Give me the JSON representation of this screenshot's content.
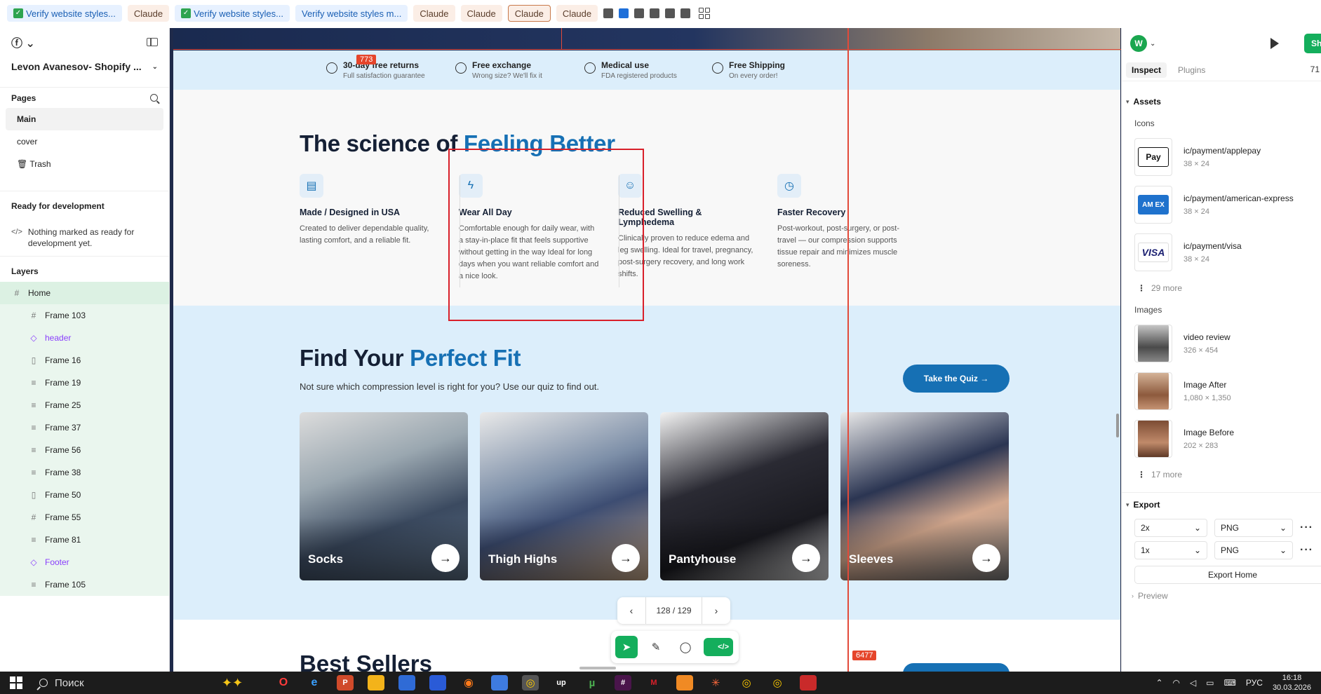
{
  "tabs": [
    {
      "label": "Verify website styles...",
      "style": "verify-g"
    },
    {
      "label": "Claude",
      "style": "claude"
    },
    {
      "label": "Verify website styles...",
      "style": "verify-g"
    },
    {
      "label": "Verify website styles m...",
      "style": "verify-b"
    },
    {
      "label": "Claude",
      "style": "claude"
    },
    {
      "label": "Claude",
      "style": "claude"
    },
    {
      "label": "Claude",
      "style": "claude active"
    },
    {
      "label": "Claude",
      "style": "claude"
    }
  ],
  "left_panel": {
    "project_name": "Levon Avanesov- Shopify ...",
    "pages_label": "Pages",
    "pages": [
      "Main",
      "cover",
      "🗑 Trash"
    ],
    "ready_label": "Ready for development",
    "ready_note": "Nothing marked as ready for development yet.",
    "layers_label": "Layers",
    "root_layer": "Home",
    "layers": [
      {
        "name": "Frame 103",
        "icon": "#",
        "kind": "frame"
      },
      {
        "name": "header",
        "icon": "◇",
        "kind": "comp"
      },
      {
        "name": "Frame 16",
        "icon": "▯",
        "kind": "frame"
      },
      {
        "name": "Frame 19",
        "icon": "≡",
        "kind": "frame"
      },
      {
        "name": "Frame 25",
        "icon": "≡",
        "kind": "frame"
      },
      {
        "name": "Frame 37",
        "icon": "≡",
        "kind": "frame"
      },
      {
        "name": "Frame 56",
        "icon": "≡",
        "kind": "frame"
      },
      {
        "name": "Frame 38",
        "icon": "≡",
        "kind": "frame"
      },
      {
        "name": "Frame 50",
        "icon": "▯",
        "kind": "frame"
      },
      {
        "name": "Frame 55",
        "icon": "#",
        "kind": "frame"
      },
      {
        "name": "Frame 81",
        "icon": "≡",
        "kind": "frame"
      },
      {
        "name": "Footer",
        "icon": "◇",
        "kind": "comp"
      },
      {
        "name": "Frame 105",
        "icon": "≡",
        "kind": "frame"
      }
    ]
  },
  "canvas": {
    "badge_top": "773",
    "badge_bottom": "6477",
    "benefits": [
      {
        "title": "30-day free returns",
        "sub": "Full satisfaction guarantee"
      },
      {
        "title": "Free exchange",
        "sub": "Wrong size? We'll fix it"
      },
      {
        "title": "Medical use",
        "sub": "FDA registered products"
      },
      {
        "title": "Free Shipping",
        "sub": "On every order!"
      }
    ],
    "science_title_a": "The science of ",
    "science_title_b": "Feeling Better",
    "features": [
      {
        "title": "Made / Designed in USA",
        "desc": "Created to deliver dependable quality, lasting comfort, and a reliable fit.",
        "icon": "▤"
      },
      {
        "title": "Wear All Day",
        "desc": "Comfortable enough for daily wear, with a stay-in-place fit that feels supportive without getting in the way Ideal for long days when you want reliable comfort and a nice look.",
        "icon": "ϟ"
      },
      {
        "title": "Reduced Swelling & Lymphedema",
        "desc": "Clinically proven to reduce edema and leg swelling. Ideal for travel, pregnancy, post-surgery recovery, and long work shifts.",
        "icon": "☺"
      },
      {
        "title": "Faster Recovery",
        "desc": "Post-workout, post-surgery, or post-travel — our compression supports tissue repair and minimizes muscle soreness.",
        "icon": "◷"
      }
    ],
    "fit_title_a": "Find Your ",
    "fit_title_b": "Perfect Fit",
    "fit_sub": "Not sure which compression level is right for you? Use our quiz to find out.",
    "quiz_label": "Take the Quiz →",
    "cards": [
      "Socks",
      "Thigh Highs",
      "Pantyhouse",
      "Sleeves"
    ],
    "bottom_title": "Best Sellers",
    "pager_text": "128 / 129"
  },
  "right_panel": {
    "avatar": "W",
    "share": "Sh",
    "tab_inspect": "Inspect",
    "tab_plugins": "Plugins",
    "zoom": "71",
    "assets_label": "Assets",
    "icons_label": "Icons",
    "icons": [
      {
        "name": "ic/payment/applepay",
        "dim": "38 × 24",
        "glyph": "Pay",
        "kind": "apple"
      },
      {
        "name": "ic/payment/american-express",
        "dim": "38 × 24",
        "glyph": "AM EX",
        "kind": "amex"
      },
      {
        "name": "ic/payment/visa",
        "dim": "38 × 24",
        "glyph": "VISA",
        "kind": "visa"
      }
    ],
    "icons_more": "29 more",
    "images_label": "Images",
    "images": [
      {
        "name": "video review",
        "dim": "326 × 454",
        "kind": "video"
      },
      {
        "name": "Image After",
        "dim": "1,080 × 1,350",
        "kind": "after"
      },
      {
        "name": "Image Before",
        "dim": "202 × 283",
        "kind": "before"
      }
    ],
    "images_more": "17 more",
    "export_label": "Export",
    "export_rows": [
      {
        "scale": "2x",
        "format": "PNG"
      },
      {
        "scale": "1x",
        "format": "PNG"
      }
    ],
    "export_button": "Export Home",
    "preview_label": "Preview"
  },
  "taskbar": {
    "search_label": "Поиск",
    "lang": "РУС",
    "time": "16:18",
    "date": "30.03.2026"
  },
  "colors": {
    "accent_blue": "#1670b4",
    "figma_green": "#14ae5c",
    "selection_red": "#d9202a"
  }
}
